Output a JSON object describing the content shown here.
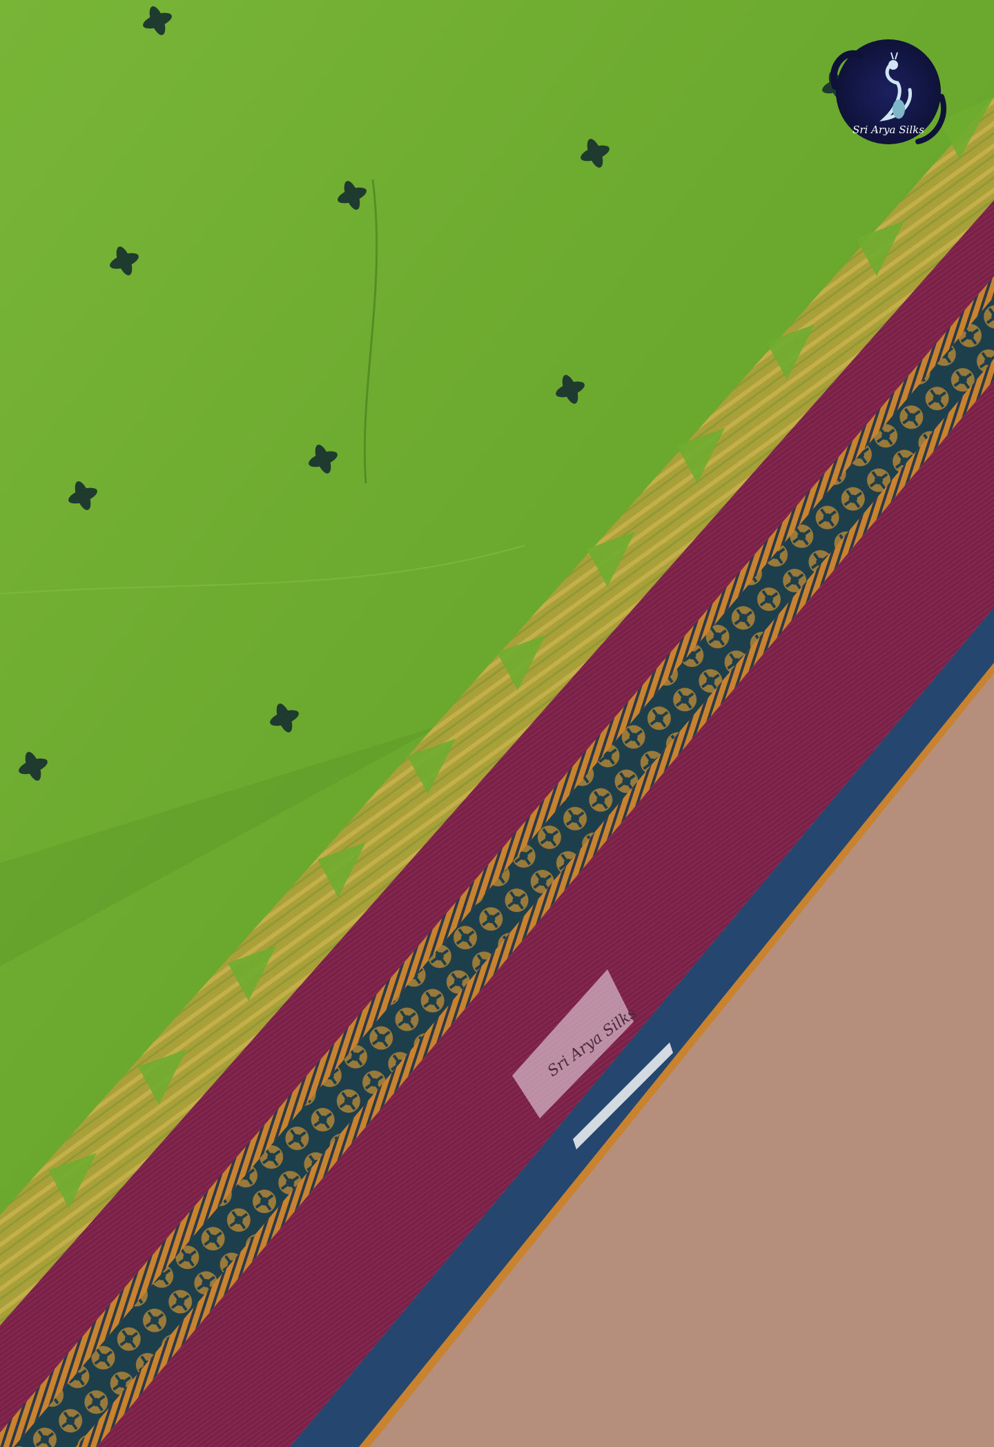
{
  "photo": {
    "subject": "saree-fabric-closeup",
    "colors": {
      "body_green": "#6fad2f",
      "zari_gold": "#b5a13a",
      "border_maroon": "#7a2149",
      "stripe_orange": "#c9822e",
      "motif_dark": "#1f3a2e",
      "selvedge_blue": "#24466f",
      "background_tan": "#b58f7c",
      "logo_navy": "#141848"
    }
  },
  "logo": {
    "brand": "Sri Arya Silks",
    "icon": "peacock-icon"
  },
  "fabric_tag": {
    "label": "Sri Arya Silks"
  }
}
